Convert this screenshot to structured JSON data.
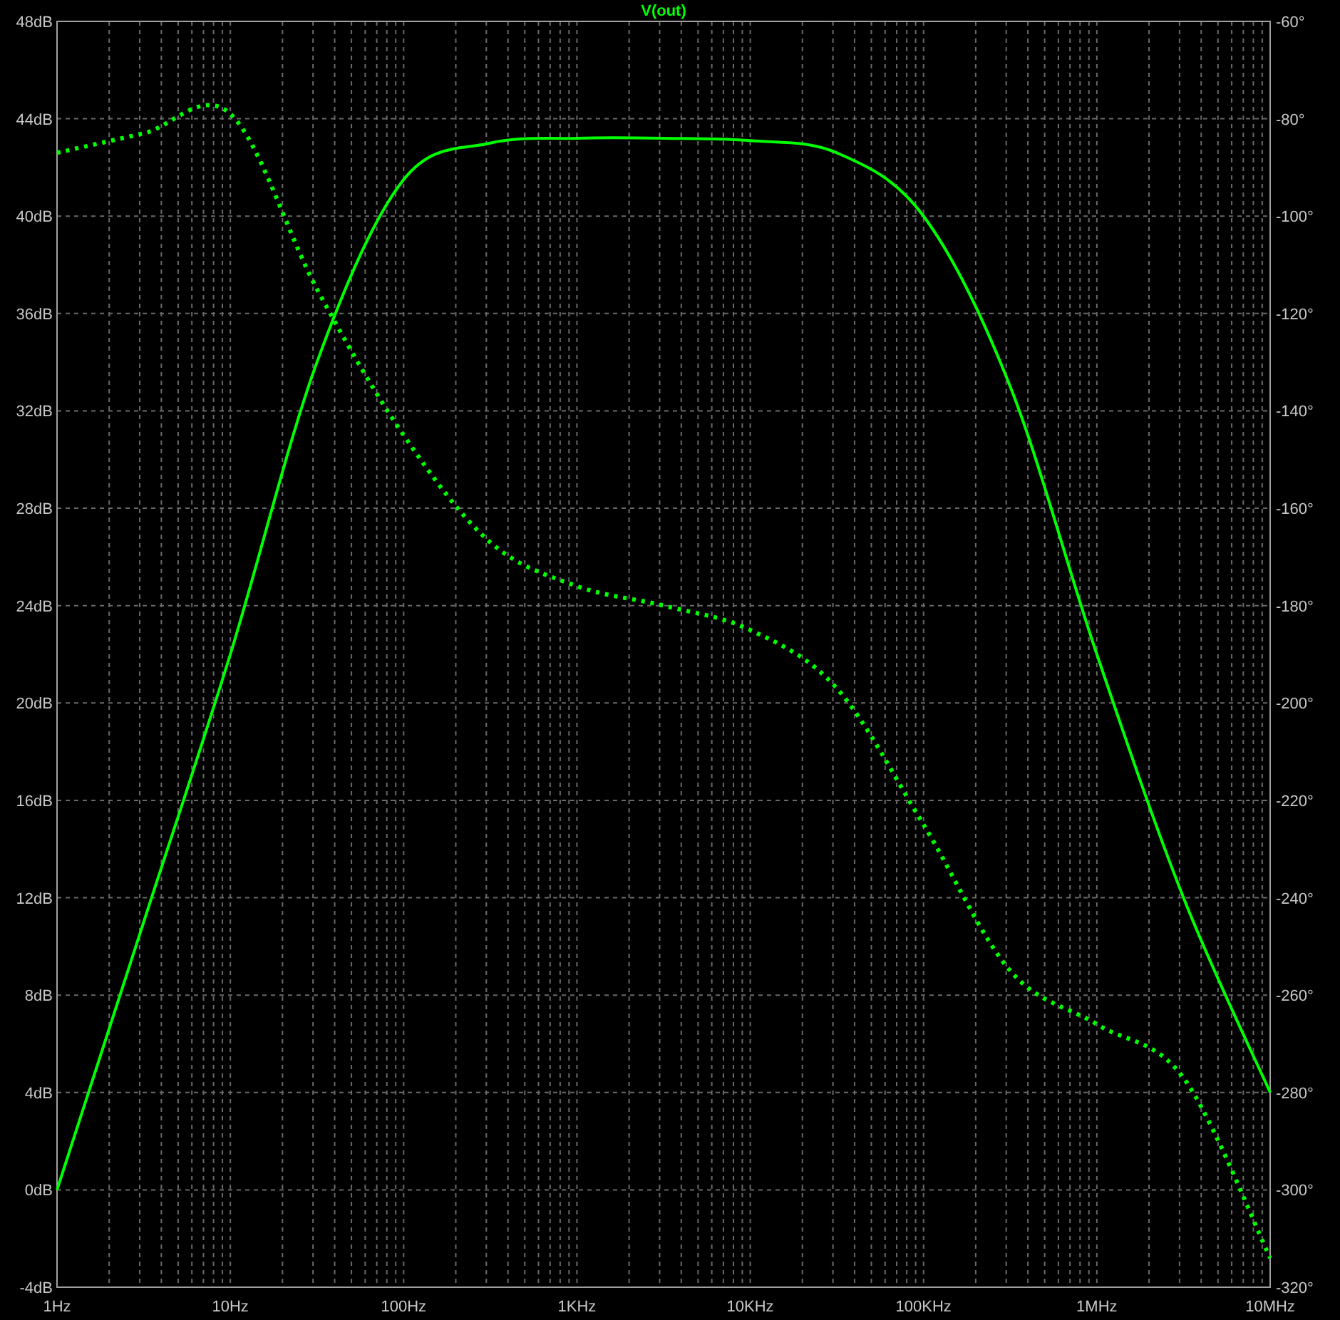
{
  "chart_data": {
    "type": "line",
    "title": "V(out)",
    "grid": true,
    "categories": [
      "1Hz",
      null,
      "10Hz",
      null,
      "100Hz",
      null,
      "1KHz",
      null,
      "10KHz",
      null,
      "100KHz",
      null,
      "1MHz",
      null,
      "10MHz"
    ],
    "ylim": [
      -4,
      48
    ],
    "yticks": [
      {
        "value": 48,
        "label": "48dB"
      },
      {
        "value": 44,
        "label": "44dB"
      },
      {
        "value": 40,
        "label": "40dB"
      },
      {
        "value": 36,
        "label": "36dB"
      },
      {
        "value": 32,
        "label": "32dB"
      },
      {
        "value": 28,
        "label": "28dB"
      },
      {
        "value": 24,
        "label": "24dB"
      },
      {
        "value": 20,
        "label": "20dB"
      },
      {
        "value": 16,
        "label": "16dB"
      },
      {
        "value": 12,
        "label": "12dB"
      },
      {
        "value": 8,
        "label": "8dB"
      },
      {
        "value": 4,
        "label": "4dB"
      },
      {
        "value": 0,
        "label": "0dB"
      },
      {
        "value": -4,
        "label": "-4dB"
      }
    ],
    "y2lim": [
      -320,
      -60
    ],
    "y2ticks": [
      {
        "value": -60,
        "label": "-60°"
      },
      {
        "value": -80,
        "label": "-80°"
      },
      {
        "value": -100,
        "label": "-100°"
      },
      {
        "value": -120,
        "label": "-120°"
      },
      {
        "value": -140,
        "label": "-140°"
      },
      {
        "value": -160,
        "label": "-160°"
      },
      {
        "value": -180,
        "label": "-180°"
      },
      {
        "value": -200,
        "label": "-200°"
      },
      {
        "value": -220,
        "label": "-220°"
      },
      {
        "value": -240,
        "label": "-240°"
      },
      {
        "value": -260,
        "label": "-260°"
      },
      {
        "value": -280,
        "label": "-280°"
      },
      {
        "value": -300,
        "label": "-300°"
      },
      {
        "value": -320,
        "label": "-320°"
      }
    ],
    "series": [
      {
        "color": "#00ff00",
        "values": [
          0,
          11,
          22,
          34,
          41.5,
          43,
          43.2,
          43.2,
          43.1,
          42.6,
          40,
          33,
          22,
          12,
          4
        ]
      },
      {
        "color": "#00ff00",
        "axis": "y2",
        "line_style": "dotted",
        "values": [
          -87,
          -83,
          -79,
          -115,
          -145,
          -167,
          -176,
          -180,
          -185,
          -197,
          -225,
          -255,
          -266,
          -277,
          -314
        ]
      }
    ]
  }
}
